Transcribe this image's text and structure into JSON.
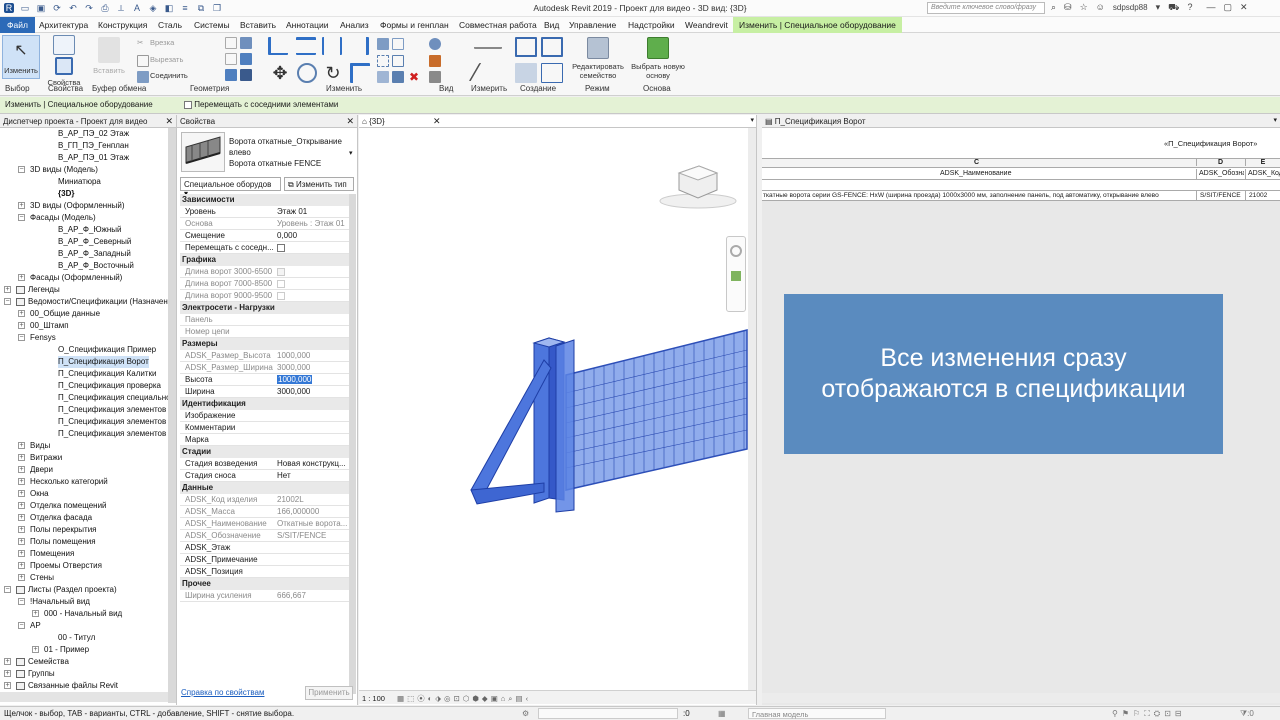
{
  "app": {
    "title": "Autodesk Revit 2019 - Проект для видео - 3D вид: {3D}",
    "search_placeholder": "Введите ключевое слово/фразу",
    "user": "sdpsdp88"
  },
  "menu": {
    "file": "Файл",
    "tabs": [
      "Архитектура",
      "Конструкция",
      "Сталь",
      "Системы",
      "Вставить",
      "Аннотации",
      "Анализ",
      "Формы и генплан",
      "Совместная работа",
      "Вид",
      "Управление",
      "Надстройки",
      "Weandrevit"
    ],
    "context_tab": "Изменить | Специальное оборудование"
  },
  "ribbon": {
    "modify": "Изменить",
    "properties": "Свойства",
    "paste": "Вставить",
    "cut": "Вырезать",
    "cope": "Врезка",
    "join": "Соединить",
    "edit_family": "Редактировать семейство",
    "pick_host": "Выбрать новую основу",
    "groups": [
      "Выбор",
      "Свойства",
      "Буфер обмена",
      "Геометрия",
      "Изменить",
      "Вид",
      "Измерить",
      "Создание",
      "Режим",
      "Основа"
    ]
  },
  "options_bar": {
    "context": "Изменить | Специальное оборудование",
    "move_with": "Перемещать с соседними элементами"
  },
  "browser": {
    "title": "Диспетчер проекта - Проект для видео",
    "nodes": [
      {
        "t": "В_АР_ПЭ_02 Этаж"
      },
      {
        "t": "В_ГП_ПЭ_Генплан"
      },
      {
        "t": "В_АР_ПЭ_01 Этаж"
      },
      {
        "t": "3D виды (Модель)"
      },
      {
        "t": "Миниатюра"
      },
      {
        "t": "{3D}"
      },
      {
        "t": "3D виды (Оформленный)"
      },
      {
        "t": "Фасады (Модель)"
      },
      {
        "t": "В_АР_Ф_Южный"
      },
      {
        "t": "В_АР_Ф_Северный"
      },
      {
        "t": "В_АР_Ф_Западный"
      },
      {
        "t": "В_АР_Ф_Восточный"
      },
      {
        "t": "Фасады (Оформленный)"
      },
      {
        "t": "Легенды"
      },
      {
        "t": "Ведомости/Спецификации (Назначен"
      },
      {
        "t": "00_Общие данные"
      },
      {
        "t": "00_Штамп"
      },
      {
        "t": "Fensys"
      },
      {
        "t": "О_Спецификация Пример"
      },
      {
        "t": "П_Спецификация Ворот"
      },
      {
        "t": "П_Спецификация Калитки"
      },
      {
        "t": "П_Спецификация проверка"
      },
      {
        "t": "П_Спецификация специального с"
      },
      {
        "t": "П_Спецификация элементов Нас"
      },
      {
        "t": "П_Спецификация элементов ПП"
      },
      {
        "t": "П_Спецификация элементов огра"
      },
      {
        "t": "Виды"
      },
      {
        "t": "Витражи"
      },
      {
        "t": "Двери"
      },
      {
        "t": "Несколько категорий"
      },
      {
        "t": "Окна"
      },
      {
        "t": "Отделка помещений"
      },
      {
        "t": "Отделка фасада"
      },
      {
        "t": "Полы перекрытия"
      },
      {
        "t": "Полы помещения"
      },
      {
        "t": "Помещения"
      },
      {
        "t": "Проемы Отверстия"
      },
      {
        "t": "Стены"
      },
      {
        "t": "Листы (Раздел проекта)"
      },
      {
        "t": "!Начальный вид"
      },
      {
        "t": "000 - Начальный вид"
      },
      {
        "t": "АР"
      },
      {
        "t": "00 - Титул"
      },
      {
        "t": "01 - Пример"
      },
      {
        "t": "Семейства"
      },
      {
        "t": "Группы"
      },
      {
        "t": "Связанные файлы Revit"
      }
    ]
  },
  "props": {
    "title": "Свойства",
    "family_line1": "Ворота откатные_Открывание",
    "family_line2": "влево",
    "family_line3": "Ворота откатные FENCE",
    "category": "Специальное оборудов",
    "edit_type": "Изменить тип",
    "sections": {
      "constraints": "Зависимости",
      "graphics": "Графика",
      "electrical": "Электросети - Нагрузки",
      "dimensions": "Размеры",
      "identity": "Идентификация",
      "phasing": "Стадии",
      "data": "Данные",
      "other": "Прочее"
    },
    "rows": {
      "level_k": "Уровень",
      "level_v": "Этаж 01",
      "host_k": "Основа",
      "host_v": "Уровень : Этаж 01",
      "offset_k": "Смещение",
      "offset_v": "0,000",
      "move_k": "Перемещать с соседн...",
      "len1_k": "Длина ворот 3000-6500",
      "len2_k": "Длина ворот 7000-8500",
      "len3_k": "Длина ворот 9000-9500",
      "panel_k": "Панель",
      "circuit_k": "Номер цепи",
      "dh_k": "ADSK_Размер_Высота",
      "dh_v": "1000,000",
      "dw_k": "ADSK_Размер_Ширина",
      "dw_v": "3000,000",
      "h_k": "Высота",
      "h_v": "1000,000",
      "w_k": "Ширина",
      "w_v": "3000,000",
      "img_k": "Изображение",
      "com_k": "Комментарии",
      "mark_k": "Марка",
      "phase_k": "Стадия возведения",
      "phase_v": "Новая конструкц...",
      "demo_k": "Стадия сноса",
      "demo_v": "Нет",
      "code_k": "ADSK_Код изделия",
      "code_v": "21002L",
      "mass_k": "ADSK_Масса",
      "mass_v": "166,000000",
      "name_k": "ADSK_Наименование",
      "name_v": "Откатные ворота...",
      "desig_k": "ADSK_Обозначение",
      "desig_v": "S/SIT/FENCE",
      "floor_k": "ADSK_Этаж",
      "note_k": "ADSK_Примечание",
      "pos_k": "ADSK_Позиция",
      "reinf_k": "Ширина усиления",
      "reinf_v": "666,667"
    },
    "help_link": "Справка по свойствам",
    "apply": "Применить"
  },
  "view3d": {
    "tab": "{3D}",
    "scale": "1 : 100"
  },
  "schedule": {
    "tab": "П_Спецификация Ворот",
    "title": "«П_Спецификация Ворот»",
    "col_c": "C",
    "col_d": "D",
    "col_e": "E",
    "hdr_c": "ADSK_Наименование",
    "hdr_d": "ADSK_Обозначе",
    "hdr_e": "ADSK_Код",
    "row_c": "ткатные ворота серии GS-FENCE: HxW (ширина проезда) 1000x3000 мм, заполнение панель, под автоматику, открывание влево",
    "row_d": "S/SIT/FENCE",
    "row_e": "21002"
  },
  "overlay": {
    "line1": "Все изменения сразу",
    "line2": "отображаются в спецификации"
  },
  "status": {
    "hint": "Щелчок - выбор, TAB - варианты, CTRL - добавление, SHIFT - снятие выбора.",
    "zero": ":0",
    "model": "Главная модель"
  },
  "colors": {
    "accent": "#2c6ab8",
    "context": "#c7efa3",
    "gate": "#3d6fe0",
    "overlay": "#5a8bbf"
  }
}
